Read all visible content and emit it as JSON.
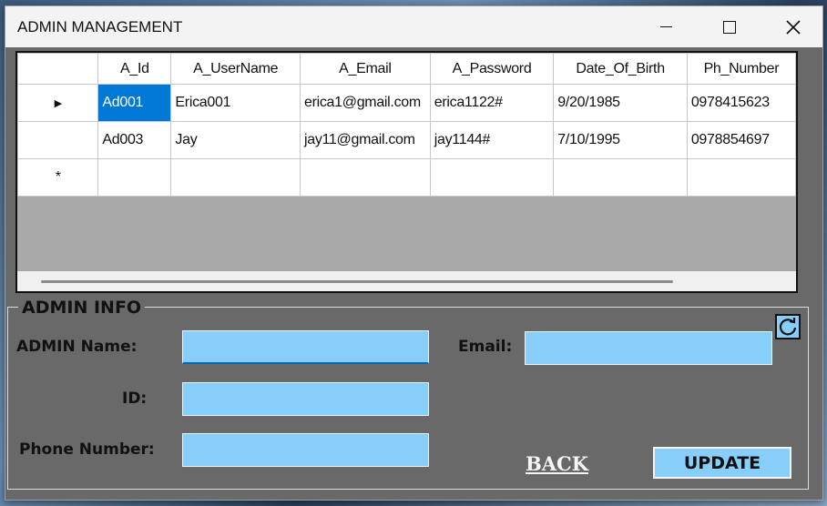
{
  "window": {
    "title": "ADMIN MANAGEMENT"
  },
  "grid": {
    "columns": [
      "A_Id",
      "A_UserName",
      "A_Email",
      "A_Password",
      "Date_Of_Birth",
      "Ph_Number"
    ],
    "rows": [
      [
        "Ad001",
        "Erica001",
        "erica1@gmail.com",
        "erica1122#",
        "9/20/1985",
        "0978415623"
      ],
      [
        "Ad003",
        "Jay",
        "jay11@gmail.com",
        "jay1144#",
        "7/10/1995",
        "0978854697"
      ]
    ],
    "new_row_marker": "*",
    "current_row_marker": "▶"
  },
  "form": {
    "group_title": "ADMIN INFO",
    "admin_name_label": "ADMIN Name:",
    "admin_name_value": "",
    "id_label": "ID:",
    "id_value": "",
    "phone_label": "Phone Number:",
    "phone_value": "",
    "email_label": "Email:",
    "email_value": "",
    "back_label": "BACK",
    "update_label": "UPDATE"
  },
  "colors": {
    "form_bg": "#696969",
    "input_bg": "#87cefa",
    "selection": "#0078d7"
  },
  "icons": {
    "refresh": "refresh-icon",
    "close": "close-icon",
    "maximize": "maximize-icon",
    "minimize": "minimize-icon"
  }
}
